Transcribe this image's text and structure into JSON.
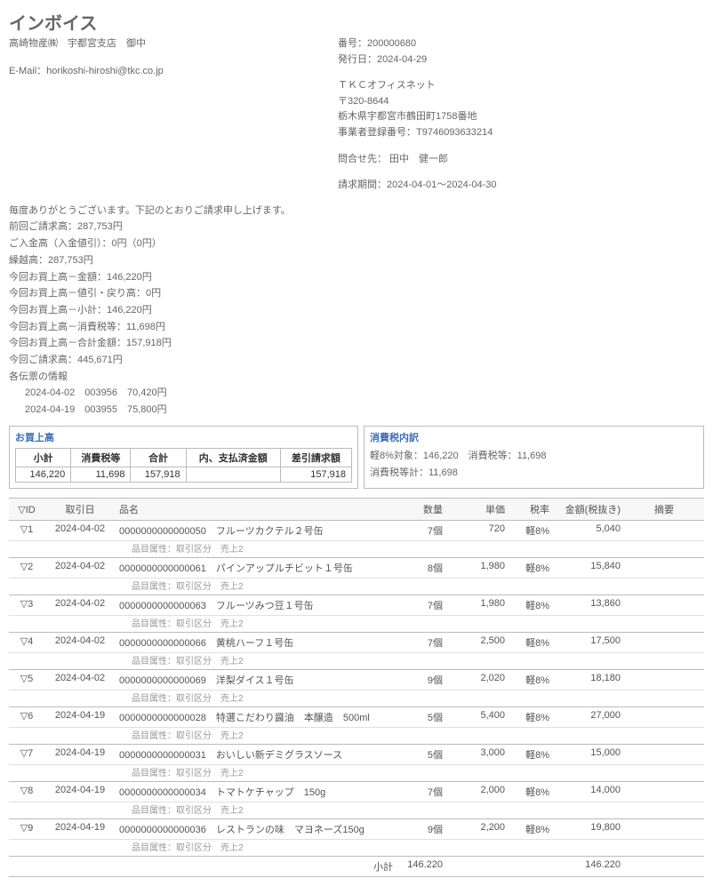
{
  "title": "インボイス",
  "customer": "高崎物産㈱　宇都宮支店　御中",
  "email_label": "E-Mail：",
  "email": "horikoshi-hiroshi@tkc.co.jp",
  "header_right": {
    "number": "番号：200000680",
    "issue": "発行日：2024-04-29",
    "company": "ＴＫＣオフィスネット",
    "zip": "〒320-8644",
    "addr": "栃木県宇都宮市鶴田町1758番地",
    "reg": "事業者登録番号：T9746093633214",
    "contact": "問合せ先： 田中　健一郎",
    "period": "請求期間：2024-04-01～2024-04-30"
  },
  "body": {
    "thanks": "毎度ありがとうございます。下記のとおりご請求申し上げます。",
    "l1": "前回ご請求高：287,753円",
    "l2": "ご入金高（入金値引）：0円（0円）",
    "l3": "繰越高：287,753円",
    "l4": "今回お買上高－金額：146,220円",
    "l5": "今回お買上高－値引・戻り高：0円",
    "l6": "今回お買上高－小計：146,220円",
    "l7": "今回お買上高－消費税等：11,698円",
    "l8": "今回お買上高－合計金額：157,918円",
    "l9": "今回ご請求高：445,671円",
    "slips_label": "各伝票の情報",
    "slip1": "2024-04-02　003956　70,420円",
    "slip2": "2024-04-19　003955　75,800円"
  },
  "summary": {
    "title": "お買上高",
    "h1": "小計",
    "h2": "消費税等",
    "h3": "合計",
    "h4": "内、支払済金額",
    "h5": "差引請求額",
    "v1": "146,220",
    "v2": "11,698",
    "v3": "157,918",
    "v4": "",
    "v5": "157,918"
  },
  "tax": {
    "title": "消費税内訳",
    "l1": "軽8%対象：146,220　消費税等：11,698",
    "l2": "消費税等計：11,698"
  },
  "cols": {
    "id": "▽ID",
    "date": "取引日",
    "name": "品名",
    "qty": "数量",
    "unit": "単価",
    "tax": "税率",
    "amt": "金額(税抜き)",
    "note": "摘要"
  },
  "sub_label": "品目属性：取引区分　売上2",
  "rows": [
    {
      "id": "▽1",
      "date": "2024-04-02",
      "code": "0000000000000050",
      "name": "フルーツカクテル２号缶",
      "qty": "7個",
      "unit": "720",
      "tax": "軽8%",
      "amt": "5,040"
    },
    {
      "id": "▽2",
      "date": "2024-04-02",
      "code": "0000000000000061",
      "name": "パインアップルチビット１号缶",
      "qty": "8個",
      "unit": "1,980",
      "tax": "軽8%",
      "amt": "15,840"
    },
    {
      "id": "▽3",
      "date": "2024-04-02",
      "code": "0000000000000063",
      "name": "フルーツみつ豆１号缶",
      "qty": "7個",
      "unit": "1,980",
      "tax": "軽8%",
      "amt": "13,860"
    },
    {
      "id": "▽4",
      "date": "2024-04-02",
      "code": "0000000000000066",
      "name": "黄桃ハーフ１号缶",
      "qty": "7個",
      "unit": "2,500",
      "tax": "軽8%",
      "amt": "17,500"
    },
    {
      "id": "▽5",
      "date": "2024-04-02",
      "code": "0000000000000069",
      "name": "洋梨ダイス１号缶",
      "qty": "9個",
      "unit": "2,020",
      "tax": "軽8%",
      "amt": "18,180"
    },
    {
      "id": "▽6",
      "date": "2024-04-19",
      "code": "0000000000000028",
      "name": "特選こだわり醤油　本醸造　500ml",
      "qty": "5個",
      "unit": "5,400",
      "tax": "軽8%",
      "amt": "27,000"
    },
    {
      "id": "▽7",
      "date": "2024-04-19",
      "code": "0000000000000031",
      "name": "おいしい新デミグラスソース",
      "qty": "5個",
      "unit": "3,000",
      "tax": "軽8%",
      "amt": "15,000"
    },
    {
      "id": "▽8",
      "date": "2024-04-19",
      "code": "0000000000000034",
      "name": "トマトケチャップ　150g",
      "qty": "7個",
      "unit": "2,000",
      "tax": "軽8%",
      "amt": "14,000"
    },
    {
      "id": "▽9",
      "date": "2024-04-19",
      "code": "0000000000000036",
      "name": "レストランの味　マヨネーズ150g",
      "qty": "9個",
      "unit": "2,200",
      "tax": "軽8%",
      "amt": "19,800"
    }
  ],
  "footer": {
    "label": "小計",
    "v1": "146.220",
    "v2": "146.220"
  }
}
